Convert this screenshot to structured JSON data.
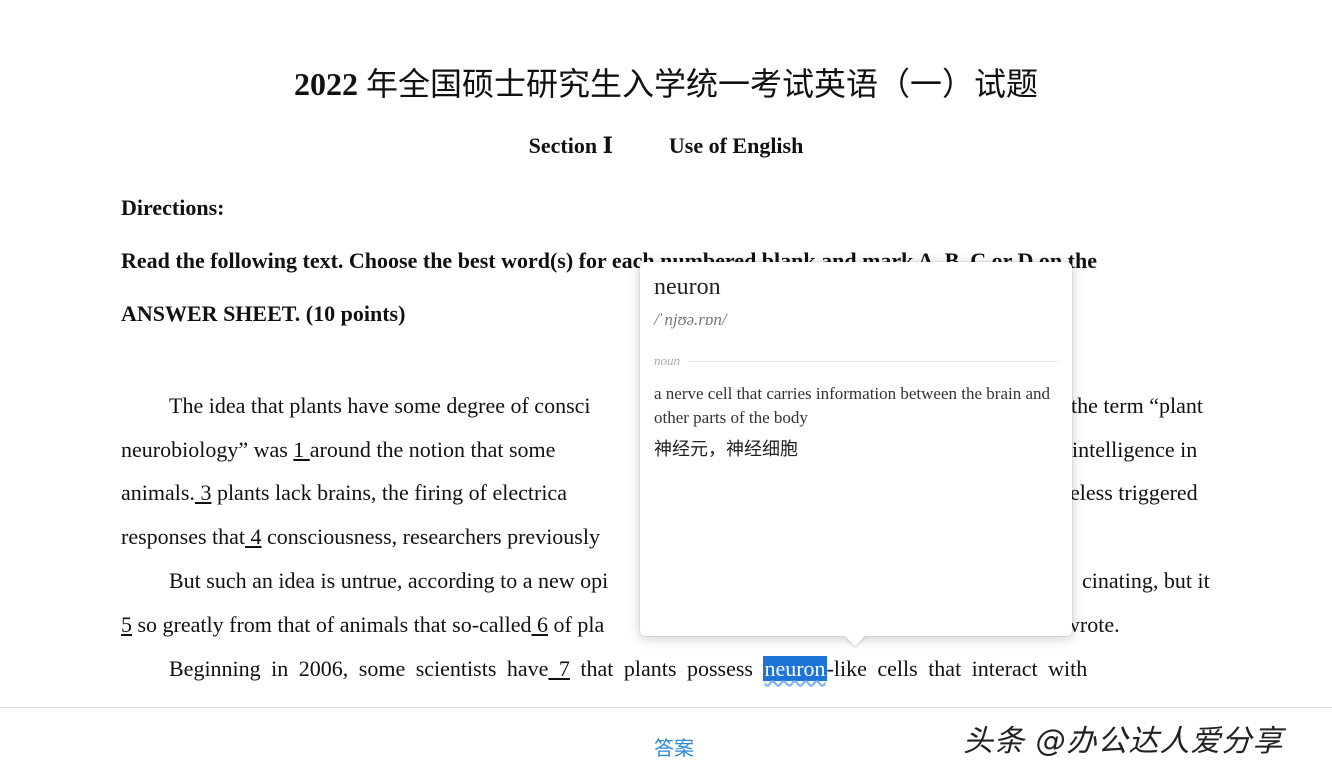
{
  "doc": {
    "title_year": "2022",
    "title_rest": " 年全国硕士研究生入学统一考试英语（一）试题",
    "section_label": "Section Ⅰ",
    "section_name": "Use of English",
    "directions_heading": "Directions:",
    "directions_line1": "Read the following text. Choose the best word(s) for each numbered blank and mark A, B, C or D on the",
    "directions_line2": "ANSWER SHEET. (10 points)"
  },
  "passage": {
    "l1a": "The idea that plants have some degree of consci",
    "l1b": "the term “plant",
    "l2a": "neurobiology” was ",
    "b1": " 1 ",
    "l2b": " around the notion that some",
    "l2c": "intelligence in",
    "l3a": "animals.",
    "b3": " 3",
    "l3b": " plants lack brains, the firing of electrica",
    "l3c": "eless triggered",
    "l4a": "responses that",
    "b4": " 4",
    "l4b": " consciousness, researchers previously",
    "l5a": "But such an idea is untrue, according to a new opi",
    "l5b": "cinating, but it",
    "b5": "5",
    "l6a": " so greatly from that of animals that so-called",
    "b6": " 6",
    "l6b": " of pla",
    "l6c": "wrote.",
    "l7a": "Beginning in 2006, some scientists have",
    "b7": " 7",
    "l7b": " that plants possess ",
    "highlight": "neuron",
    "l7c": "-like cells that interact with"
  },
  "popup": {
    "word": "neuron",
    "phonetic": "/ˈnjʊə.rɒn/",
    "pos": "noun",
    "definition": "a nerve cell that carries information between the brain and other parts of the body",
    "translation": "神经元，神经细胞"
  },
  "footer": {
    "answer_label": "答案",
    "watermark": "头条 @办公达人爱分享"
  },
  "colors": {
    "link": "#2e86de",
    "highlight_bg": "#1e73d8"
  }
}
